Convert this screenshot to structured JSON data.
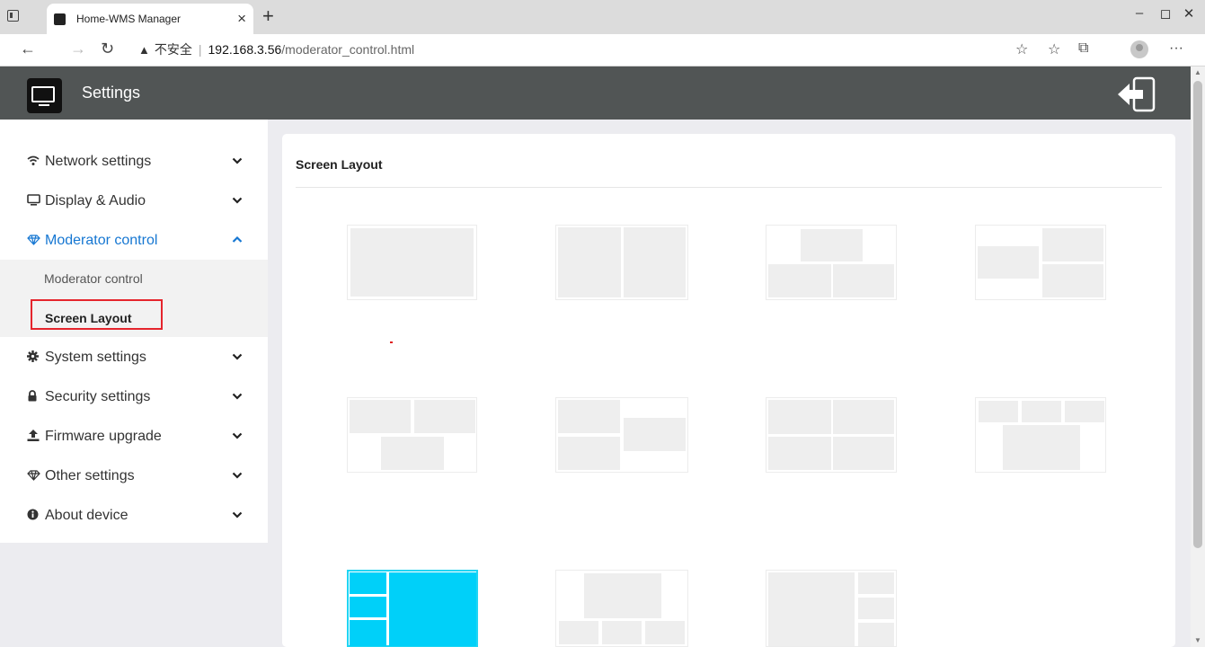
{
  "browser": {
    "tab_title": "Home-WMS Manager",
    "tab_close": "×",
    "new_tab": "+",
    "win_min": "–",
    "win_restore": "◻",
    "win_close": "✕",
    "security_icon": "▲",
    "security_label": "不安全",
    "url_host": "192.168.3.56",
    "url_path": "/moderator_control.html",
    "more": "···"
  },
  "header": {
    "title": "Settings"
  },
  "sidebar": {
    "items": [
      {
        "label": "Network settings",
        "icon": "wifi-icon"
      },
      {
        "label": "Display & Audio",
        "icon": "monitor-icon"
      },
      {
        "label": "Moderator control",
        "icon": "diamond-icon"
      },
      {
        "label": "System settings",
        "icon": "gear-icon"
      },
      {
        "label": "Security settings",
        "icon": "lock-icon"
      },
      {
        "label": "Firmware upgrade",
        "icon": "upload-icon"
      },
      {
        "label": "Other settings",
        "icon": "diamond-icon"
      },
      {
        "label": "About device",
        "icon": "info-icon"
      }
    ],
    "sub_items": [
      {
        "label": "Moderator control"
      },
      {
        "label": "Screen Layout"
      }
    ]
  },
  "main": {
    "title": "Screen Layout",
    "selected_layout": 9,
    "layouts_count": 11
  },
  "colors": {
    "accent": "#1677d2",
    "header_bg": "#515555",
    "selected": "#00d0f9",
    "highlight_border": "#e5252d"
  }
}
